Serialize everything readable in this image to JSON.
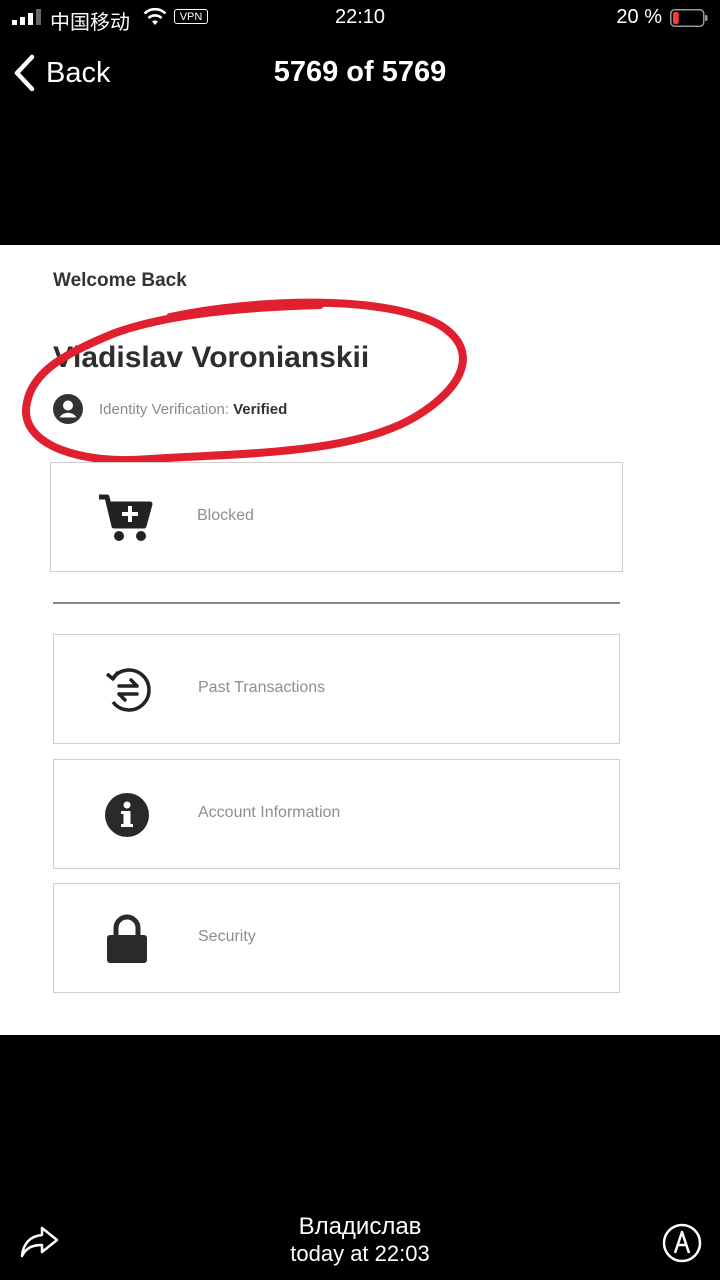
{
  "status_bar": {
    "carrier": "中国移动",
    "vpn": "VPN",
    "time": "22:10",
    "battery_text": "20 %",
    "battery_level": 0.2,
    "battery_color": "#ff3b30"
  },
  "nav": {
    "back_label": "Back",
    "title": "5769 of 5769"
  },
  "page": {
    "welcome": "Welcome Back",
    "user_name": "Vladislav Voronianskii",
    "identity_label": "Identity Verification:",
    "identity_status": "Verified",
    "annotation_color": "#e0202f",
    "cards": {
      "blocked": {
        "label": "Blocked",
        "icon": "cart-plus-icon"
      },
      "past": {
        "label": "Past Transactions",
        "icon": "exchange-icon"
      },
      "account": {
        "label": "Account Information",
        "icon": "info-icon"
      },
      "security": {
        "label": "Security",
        "icon": "lock-icon"
      }
    }
  },
  "footer": {
    "sender": "Владислав",
    "sent_time": "today at 22:03"
  }
}
